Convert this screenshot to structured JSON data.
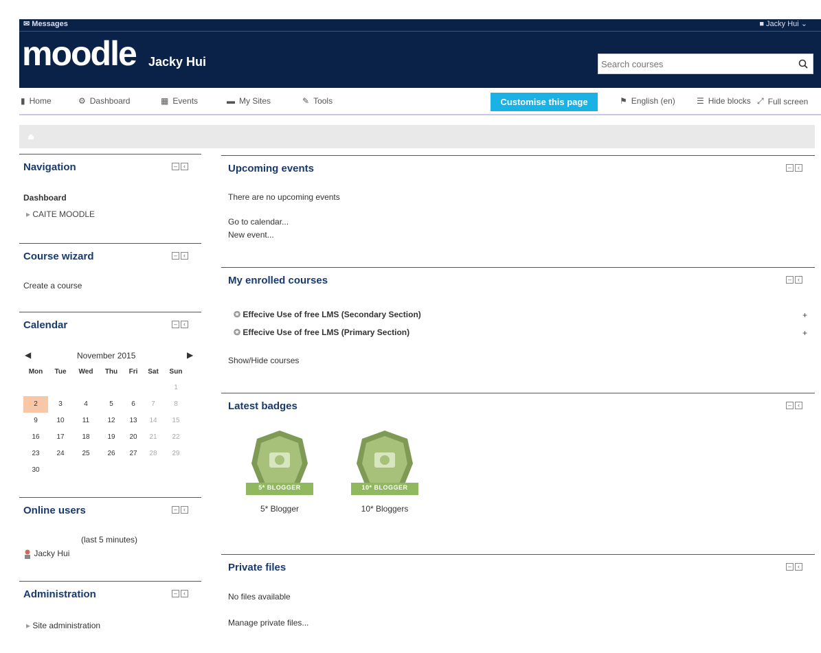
{
  "header": {
    "messages_label": "Messages",
    "user_label": "Jacky Hui",
    "logo_text": "moodle",
    "site_name": "Jacky Hui",
    "search_placeholder": "Search courses"
  },
  "nav": {
    "home": "Home",
    "dashboard": "Dashboard",
    "events": "Events",
    "my_sites": "My Sites",
    "tools": "Tools",
    "customise": "Customise this page",
    "language": "English (en)",
    "hide_blocks": "Hide blocks",
    "full_screen": "Full screen"
  },
  "navigation_block": {
    "title": "Navigation",
    "dashboard": "Dashboard",
    "item": "CAITE MOODLE"
  },
  "course_wizard": {
    "title": "Course wizard",
    "create": "Create a course"
  },
  "calendar": {
    "title": "Calendar",
    "month": "November 2015",
    "days": [
      "Mon",
      "Tue",
      "Wed",
      "Thu",
      "Fri",
      "Sat",
      "Sun"
    ],
    "weeks": [
      [
        "",
        "",
        "",
        "",
        "",
        "",
        "1"
      ],
      [
        "2",
        "3",
        "4",
        "5",
        "6",
        "7",
        "8"
      ],
      [
        "9",
        "10",
        "11",
        "12",
        "13",
        "14",
        "15"
      ],
      [
        "16",
        "17",
        "18",
        "19",
        "20",
        "21",
        "22"
      ],
      [
        "23",
        "24",
        "25",
        "26",
        "27",
        "28",
        "29"
      ],
      [
        "30",
        "",
        "",
        "",
        "",
        "",
        ""
      ]
    ],
    "today": "2"
  },
  "online_users": {
    "title": "Online users",
    "period": "(last 5 minutes)",
    "user": "Jacky Hui"
  },
  "administration": {
    "title": "Administration",
    "item": "Site administration"
  },
  "upcoming": {
    "title": "Upcoming events",
    "empty": "There are no upcoming events",
    "goto": "Go to calendar...",
    "new_event": "New event..."
  },
  "enrolled": {
    "title": "My enrolled courses",
    "courses": [
      "Effecive Use of free LMS (Secondary Section)",
      "Effecive Use of free LMS (Primary Section)"
    ],
    "toggle": "Show/Hide courses"
  },
  "badges": {
    "title": "Latest badges",
    "items": [
      {
        "ribbon": "5* BLOGGER",
        "label": "5* Blogger"
      },
      {
        "ribbon": "10* BLOGGER",
        "label": "10* Bloggers"
      }
    ]
  },
  "private_files": {
    "title": "Private files",
    "empty": "No files available",
    "manage": "Manage private files..."
  }
}
